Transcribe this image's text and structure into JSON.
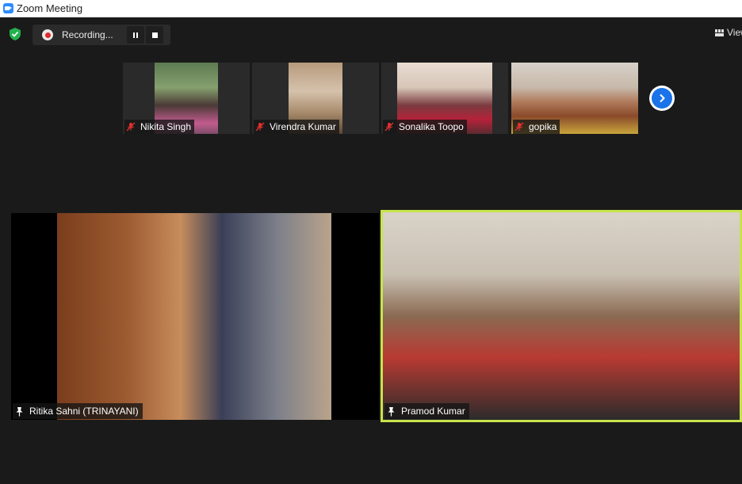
{
  "window": {
    "title": "Zoom Meeting"
  },
  "colors": {
    "accent_blue": "#1a73e8",
    "active_speaker_border": "#c7e34c",
    "record_red": "#e02828",
    "shield_green": "#23b14d",
    "mic_muted_red": "#e0302f"
  },
  "toolbar": {
    "security_icon": "shield-check-icon",
    "recording_label": "Recording...",
    "pause_icon": "pause-icon",
    "stop_icon": "stop-icon",
    "view_label": "View"
  },
  "thumbnails": {
    "participants": [
      {
        "name": "Nikita Singh",
        "muted": true
      },
      {
        "name": "Virendra Kumar",
        "muted": true
      },
      {
        "name": "Sonalika Toopo",
        "muted": true
      },
      {
        "name": "gopika",
        "muted": true
      }
    ],
    "next_icon": "chevron-right-icon"
  },
  "main_videos": [
    {
      "name": "Ritika Sahni (TRINAYANI)",
      "pinned": true
    },
    {
      "name": "Pramod Kumar",
      "pinned": true,
      "active_speaker": true
    }
  ]
}
